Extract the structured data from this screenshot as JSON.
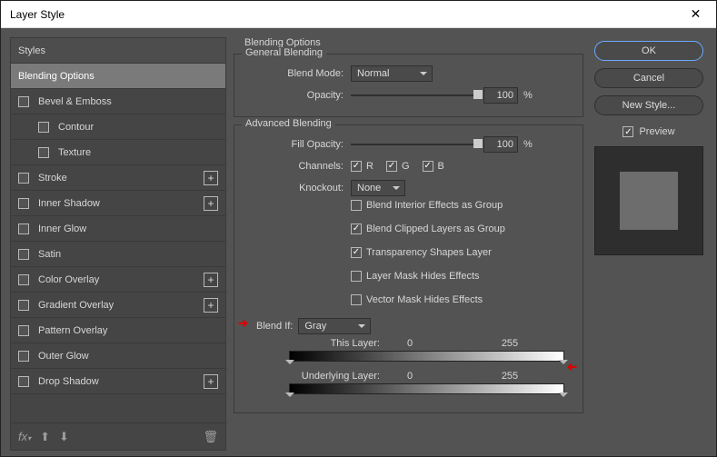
{
  "window": {
    "title": "Layer Style"
  },
  "sidebar": {
    "styles_header": "Styles",
    "items": [
      {
        "label": "Blending Options",
        "active": true,
        "checkbox": false
      },
      {
        "label": "Bevel & Emboss",
        "checkbox": true
      },
      {
        "label": "Contour",
        "checkbox": true,
        "indent": true
      },
      {
        "label": "Texture",
        "checkbox": true,
        "indent": true
      },
      {
        "label": "Stroke",
        "checkbox": true,
        "plus": true
      },
      {
        "label": "Inner Shadow",
        "checkbox": true,
        "plus": true
      },
      {
        "label": "Inner Glow",
        "checkbox": true
      },
      {
        "label": "Satin",
        "checkbox": true
      },
      {
        "label": "Color Overlay",
        "checkbox": true,
        "plus": true
      },
      {
        "label": "Gradient Overlay",
        "checkbox": true,
        "plus": true
      },
      {
        "label": "Pattern Overlay",
        "checkbox": true
      },
      {
        "label": "Outer Glow",
        "checkbox": true
      },
      {
        "label": "Drop Shadow",
        "checkbox": true,
        "plus": true
      }
    ],
    "foot": {
      "fx": "fx",
      "trash": "🗑"
    }
  },
  "middle": {
    "title": "Blending Options",
    "general": {
      "legend": "General Blending",
      "blend_mode_label": "Blend Mode:",
      "blend_mode_value": "Normal",
      "opacity_label": "Opacity:",
      "opacity_value": "100",
      "opacity_unit": "%"
    },
    "advanced": {
      "legend": "Advanced Blending",
      "fill_label": "Fill Opacity:",
      "fill_value": "100",
      "fill_unit": "%",
      "channels_label": "Channels:",
      "ch_r": "R",
      "ch_g": "G",
      "ch_b": "B",
      "knockout_label": "Knockout:",
      "knockout_value": "None",
      "opts": [
        {
          "label": "Blend Interior Effects as Group",
          "on": false
        },
        {
          "label": "Blend Clipped Layers as Group",
          "on": true
        },
        {
          "label": "Transparency Shapes Layer",
          "on": true
        },
        {
          "label": "Layer Mask Hides Effects",
          "on": false
        },
        {
          "label": "Vector Mask Hides Effects",
          "on": false
        }
      ]
    },
    "blendif": {
      "label": "Blend If:",
      "value": "Gray",
      "this_label": "This Layer:",
      "this_low": "0",
      "this_high": "255",
      "under_label": "Underlying Layer:",
      "under_low": "0",
      "under_high": "255"
    }
  },
  "right": {
    "ok": "OK",
    "cancel": "Cancel",
    "newstyle": "New Style...",
    "preview": "Preview"
  }
}
